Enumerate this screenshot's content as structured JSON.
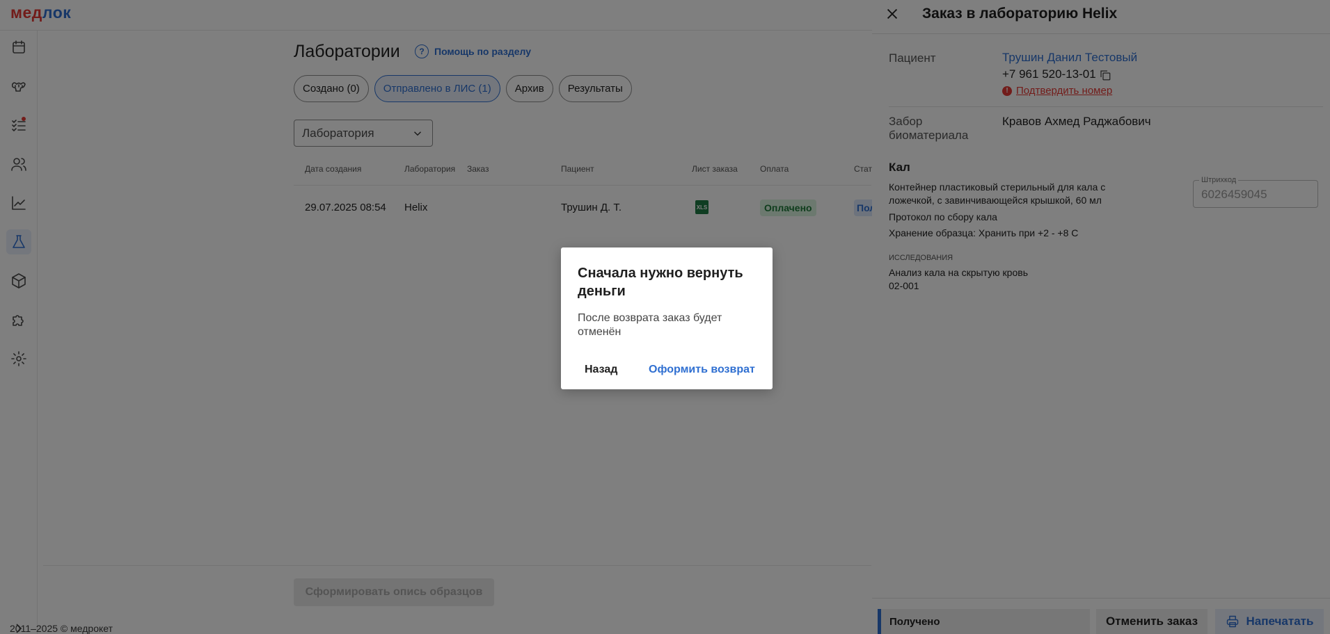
{
  "app": {
    "logo_part1": "мед",
    "logo_part2": "лок",
    "copyright": "2011–2025 © медрокет"
  },
  "sidebar": {
    "items": [
      {
        "name": "calendar-icon"
      },
      {
        "name": "tooth-icon"
      },
      {
        "name": "checklist-icon",
        "has_badge": true
      },
      {
        "name": "users-icon"
      },
      {
        "name": "chart-icon"
      },
      {
        "name": "flask-icon",
        "active": true
      },
      {
        "name": "box-icon"
      },
      {
        "name": "puzzle-icon"
      },
      {
        "name": "gear-icon"
      }
    ],
    "expand_icon": "chevron-right-icon"
  },
  "page": {
    "title": "Лаборатории",
    "help_label": "Помощь по разделу",
    "tabs": [
      {
        "label": "Создано (0)",
        "active": false
      },
      {
        "label": "Отправлено в ЛИС (1)",
        "active": true
      },
      {
        "label": "Архив",
        "active": false
      },
      {
        "label": "Результаты",
        "active": false
      }
    ],
    "lab_select": {
      "placeholder": "Лаборатория"
    },
    "table": {
      "headers": [
        "Дата создания",
        "Лаборатория",
        "Заказ",
        "Пациент",
        "Лист заказа",
        "Оплата",
        "Стат"
      ],
      "rows": [
        {
          "date": "29.07.2025 08:54",
          "lab": "Helix",
          "order": "",
          "patient": "Трушин Д. Т.",
          "sheet_icon": "xls-file-icon",
          "payment": "Оплачено",
          "status": "Получено"
        }
      ]
    },
    "inventory_button": "Сформировать опись образцов"
  },
  "panel": {
    "title": "Заказ в лабораторию Helix",
    "patient_label": "Пациент",
    "patient_name": "Трушин Данил Тестовый",
    "phone": "+7 961 520-13-01",
    "confirm_phone": "Подтвердить номер",
    "collector_label_1": "Забор",
    "collector_label_2": "биоматериала",
    "collector_name": "Кравов Ахмед Раджабович",
    "section_title": "Кал",
    "container_line1": "Контейнер пластиковый стерильный для кала с",
    "container_line2": "ложечкой, с завинчивающейся крышкой, 60 мл",
    "protocol": "Протокол по сбору кала",
    "storage": "Хранение образца: Хранить при +2 - +8 С",
    "barcode_label": "Штрихкод",
    "barcode_value": "6026459045",
    "studies_caption": "исследования",
    "study_name": "Анализ кала на скрытую кровь",
    "study_code": "02-001",
    "status_received": "Получено",
    "cancel_order": "Отменить заказ",
    "print": "Напечатать"
  },
  "modal": {
    "title": "Сначала нужно вернуть деньги",
    "text": "После возврата заказ будет отменён",
    "back": "Назад",
    "refund": "Оформить возврат"
  },
  "colors": {
    "accent": "#2f6fd1",
    "danger": "#e53935",
    "paid_bg": "#d8f2de",
    "paid_text": "#1f7a3a"
  }
}
